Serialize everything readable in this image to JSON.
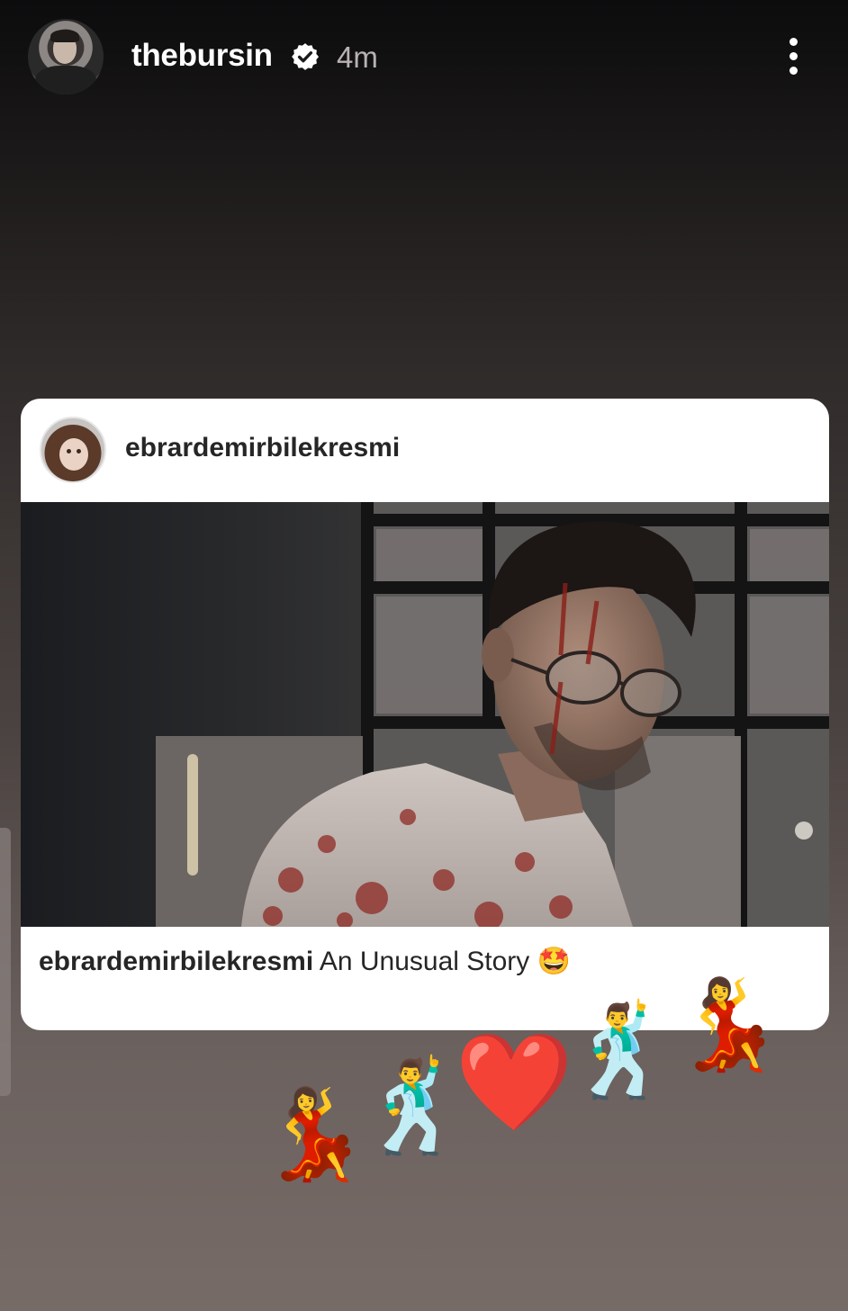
{
  "story": {
    "username": "thebursin",
    "time": "4m"
  },
  "post": {
    "username": "ebrardemirbilekresmi",
    "caption_user": "ebrardemirbilekresmi",
    "caption_text": "An Unusual Story",
    "caption_emoji": "🤩"
  },
  "stickers": [
    {
      "emoji": "💃"
    },
    {
      "emoji": "🕺"
    },
    {
      "emoji": "❤️"
    },
    {
      "emoji": "🕺"
    },
    {
      "emoji": "💃"
    }
  ],
  "icons": {
    "verified": "verified-badge-icon",
    "more": "more-vertical-icon"
  },
  "colors": {
    "text_primary": "#ffffff",
    "text_secondary": "#b8b3b1",
    "card_bg": "#ffffff",
    "card_text": "#262626",
    "heart": "#e0242b"
  }
}
